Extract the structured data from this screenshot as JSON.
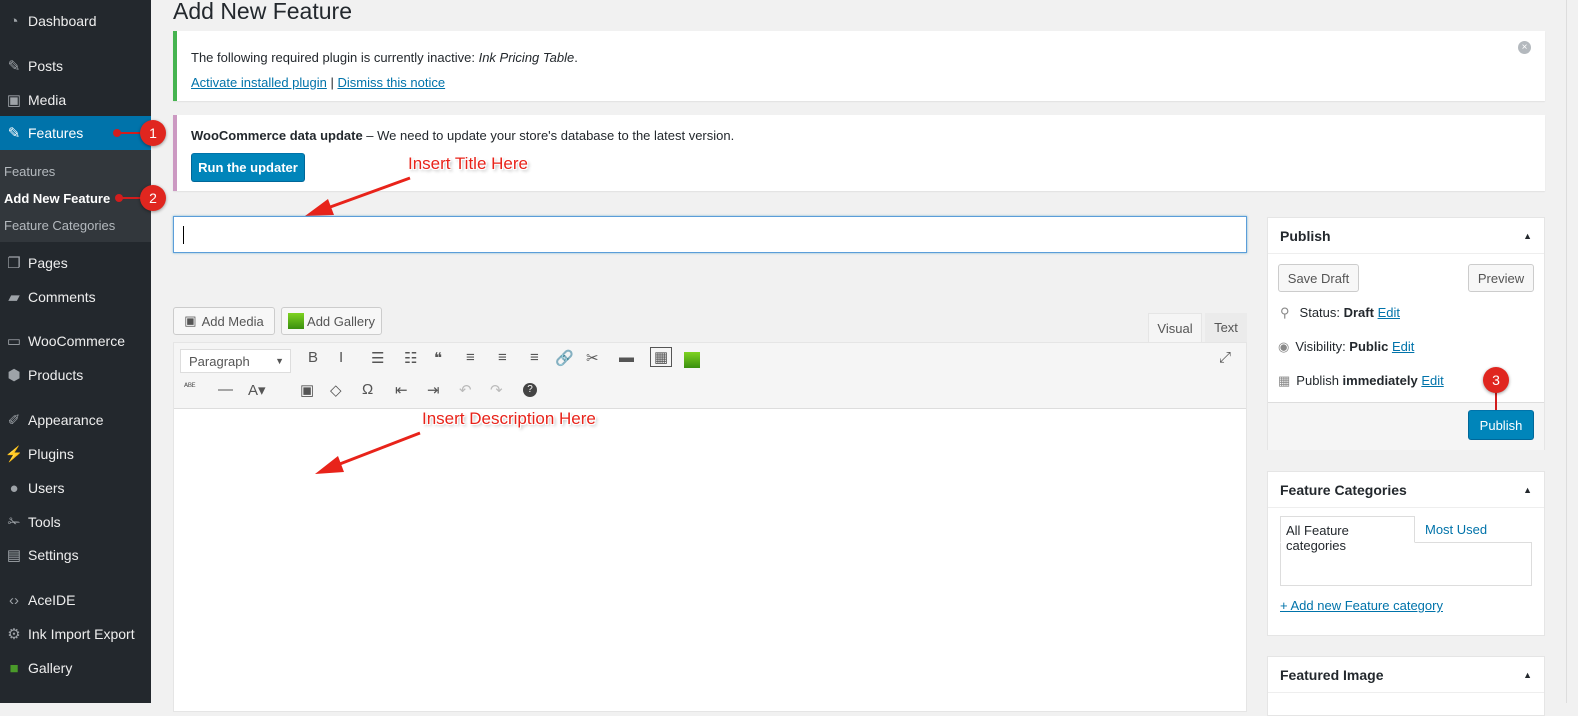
{
  "sidebar": {
    "items": [
      {
        "label": "Dashboard",
        "icon": "dashboard-icon"
      },
      {
        "label": "Posts",
        "icon": "pin-icon"
      },
      {
        "label": "Media",
        "icon": "media-icon"
      },
      {
        "label": "Features",
        "icon": "pin-icon"
      },
      {
        "label": "Pages",
        "icon": "pages-icon"
      },
      {
        "label": "Comments",
        "icon": "comment-icon"
      },
      {
        "label": "WooCommerce",
        "icon": "woo-icon"
      },
      {
        "label": "Products",
        "icon": "box-icon"
      },
      {
        "label": "Appearance",
        "icon": "brush-icon"
      },
      {
        "label": "Plugins",
        "icon": "plug-icon"
      },
      {
        "label": "Users",
        "icon": "user-icon"
      },
      {
        "label": "Tools",
        "icon": "wrench-icon"
      },
      {
        "label": "Settings",
        "icon": "settings-icon"
      },
      {
        "label": "AceIDE",
        "icon": "code-icon"
      },
      {
        "label": "Ink Import Export",
        "icon": "gear-icon"
      },
      {
        "label": "Gallery",
        "icon": "gallery-icon"
      }
    ],
    "submenu": [
      "Features",
      "Add New Feature",
      "Feature Categories"
    ]
  },
  "page_title": "Add New Feature",
  "notice1": {
    "text": "The following required plugin is currently inactive: ",
    "plugin": "Ink Pricing Table",
    "end": ".",
    "activate": "Activate installed plugin",
    "sep": " | ",
    "dismiss": "Dismiss this notice"
  },
  "notice2": {
    "strong": "WooCommerce data update",
    "text": " – We need to update your store's database to the latest version.",
    "button": "Run the updater"
  },
  "annotations": {
    "title": "Insert Title Here",
    "desc": "Insert Description Here",
    "b1": "1",
    "b2": "2",
    "b3": "3"
  },
  "editor": {
    "add_media": "Add Media",
    "add_gallery": "Add Gallery",
    "tab_visual": "Visual",
    "tab_text": "Text",
    "format": "Paragraph",
    "title_value": ""
  },
  "publish": {
    "title": "Publish",
    "save_draft": "Save Draft",
    "preview": "Preview",
    "status_label": "Status: ",
    "status": "Draft",
    "visibility_label": "Visibility: ",
    "visibility": "Public",
    "publish_label": "Publish ",
    "publish_when": "immediately",
    "edit": "Edit",
    "button": "Publish"
  },
  "categories": {
    "title": "Feature Categories",
    "tab_all": "All Feature categories",
    "tab_used": "Most Used",
    "add": "+ Add new Feature category"
  },
  "featured_image": {
    "title": "Featured Image"
  }
}
